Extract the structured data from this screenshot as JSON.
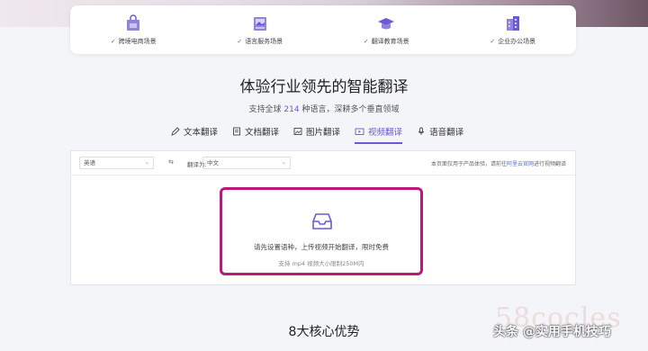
{
  "scenarios": [
    {
      "label": "跨境电商场景",
      "icon": "shopping-bag-icon"
    },
    {
      "label": "语言服务场景",
      "icon": "document-picture-icon"
    },
    {
      "label": "翻译教育场景",
      "icon": "graduation-cap-icon"
    },
    {
      "label": "企业办公场景",
      "icon": "office-building-icon"
    }
  ],
  "headline": "体验行业领先的智能翻译",
  "subline": {
    "prefix": "支持全球",
    "count": "214",
    "suffix": "种语言，深耕多个垂直领域"
  },
  "tabs": [
    {
      "label": "文本翻译",
      "active": false
    },
    {
      "label": "文档翻译",
      "active": false
    },
    {
      "label": "图片翻译",
      "active": false
    },
    {
      "label": "视频翻译",
      "active": true
    },
    {
      "label": "语音翻译",
      "active": false
    }
  ],
  "toolbar": {
    "source_lang": "英语",
    "arrow": "⇆",
    "target_label": "翻译为:",
    "target_lang": "中文",
    "notice_prefix": "本页面仅用于产品体验，请前往",
    "notice_link": "阿里云官网",
    "notice_suffix": "进行视频翻译"
  },
  "upload": {
    "main_text": "请先设置语种，上传视频开始翻译，限时免费",
    "hint_text": "支持 mp4 视频大小限制250M内"
  },
  "section_title": "8大核心优势",
  "watermark": {
    "bg_text": "58cocles",
    "text": "头条 @实用手机技巧"
  },
  "colors": {
    "accent": "#6a5ad6",
    "highlight_border": "#b8197a"
  }
}
